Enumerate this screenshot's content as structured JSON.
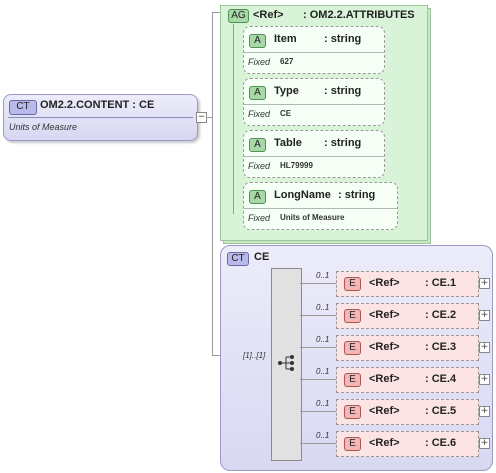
{
  "content_type": {
    "badge": "CT",
    "name": "OM2.2.CONTENT : CE",
    "description": "Units of Measure"
  },
  "attribute_group": {
    "badge": "AG",
    "ref_label": "<Ref>",
    "name": ": OM2.2.ATTRIBUTES",
    "attributes": [
      {
        "badge": "A",
        "name": "Item",
        "type": ": string",
        "fixed_label": "Fixed",
        "fixed_value": "627"
      },
      {
        "badge": "A",
        "name": "Type",
        "type": ": string",
        "fixed_label": "Fixed",
        "fixed_value": "CE"
      },
      {
        "badge": "A",
        "name": "Table",
        "type": ": string",
        "fixed_label": "Fixed",
        "fixed_value": "HL79999"
      },
      {
        "badge": "A",
        "name": "LongName",
        "type": ": string",
        "fixed_label": "Fixed",
        "fixed_value": "Units of Measure"
      }
    ]
  },
  "ce_type": {
    "badge": "CT",
    "name": "CE",
    "sequence_cardinality": "[1]..[1]",
    "elements": [
      {
        "badge": "E",
        "cardinality": "0..1",
        "ref_label": "<Ref>",
        "name": ": CE.1"
      },
      {
        "badge": "E",
        "cardinality": "0..1",
        "ref_label": "<Ref>",
        "name": ": CE.2"
      },
      {
        "badge": "E",
        "cardinality": "0..1",
        "ref_label": "<Ref>",
        "name": ": CE.3"
      },
      {
        "badge": "E",
        "cardinality": "0..1",
        "ref_label": "<Ref>",
        "name": ": CE.4"
      },
      {
        "badge": "E",
        "cardinality": "0..1",
        "ref_label": "<Ref>",
        "name": ": CE.5"
      },
      {
        "badge": "E",
        "cardinality": "0..1",
        "ref_label": "<Ref>",
        "name": ": CE.6"
      }
    ]
  },
  "expand_symbol": "+",
  "collapse_symbol": "−"
}
